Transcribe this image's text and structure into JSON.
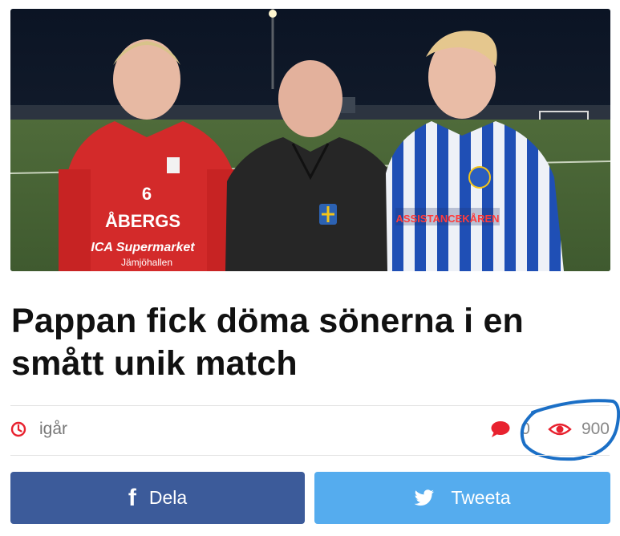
{
  "article": {
    "title": "Pappan fick döma sönerna i en smått unik match",
    "image_alt": "Tre personer på en fotbollsplan: en spelare i röd tröja, en domare i svart och en spelare i blårandig tröja",
    "image_texts": {
      "red_shirt_number": "6",
      "red_shirt_sponsor": "ÅBERGS",
      "red_shirt_ica": "ICA Supermarket",
      "red_shirt_place": "Jämjöhallen",
      "blue_shirt_sponsor": "ASSISTANCEKÅREN"
    }
  },
  "meta": {
    "time": "igår",
    "comments_count": "0",
    "views_count": "900"
  },
  "share": {
    "facebook_label": "Dela",
    "twitter_label": "Tweeta"
  },
  "icons": {
    "time": "clock-icon",
    "comments": "speech-bubble-icon",
    "views": "eye-icon",
    "facebook": "facebook-f-icon",
    "twitter": "twitter-bird-icon"
  },
  "colors": {
    "accent_red": "#e8222f",
    "facebook_blue": "#3c5b9a",
    "twitter_blue": "#55acee",
    "annotation_blue": "#1b6fc6"
  }
}
